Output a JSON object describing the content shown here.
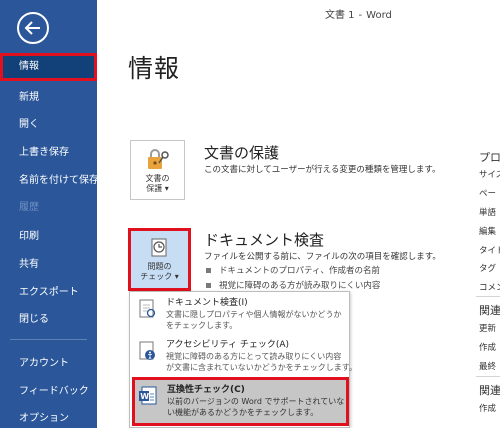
{
  "window": {
    "title": "文書 1",
    "dash": "-",
    "app": "Word"
  },
  "sidebar": {
    "items": [
      {
        "label": "情報"
      },
      {
        "label": "新規"
      },
      {
        "label": "開く"
      },
      {
        "label": "上書き保存"
      },
      {
        "label": "名前を付けて保存"
      },
      {
        "label": "履歴"
      },
      {
        "label": "印刷"
      },
      {
        "label": "共有"
      },
      {
        "label": "エクスポート"
      },
      {
        "label": "閉じる"
      },
      {
        "label": "アカウント"
      },
      {
        "label": "フィードバック"
      },
      {
        "label": "オプション"
      }
    ]
  },
  "page": {
    "title": "情報"
  },
  "protect": {
    "button_line1": "文書の",
    "button_line2": "保護",
    "title": "文書の保護",
    "desc": "この文書に対してユーザーが行える変更の種類を管理します。"
  },
  "inspect": {
    "button_line1": "問題の",
    "button_line2": "チェック",
    "title": "ドキュメント検査",
    "desc": "ファイルを公開する前に、ファイルの次の項目を確認します。",
    "bullets": [
      "ドキュメントのプロパティ、作成者の名前",
      "視覚に障碍のある方が読み取りにくい内容"
    ]
  },
  "menu": {
    "items": [
      {
        "title": "ドキュメント検査(I)",
        "desc1": "文書に隠しプロパティや個人情報がないかどうか",
        "desc2": "をチェックします。"
      },
      {
        "title": "アクセシビリティ チェック(A)",
        "desc1": "視覚に障碍のある方にとって読み取りにくい内容",
        "desc2": "が文書に含まれていないかどうかをチェックします。"
      },
      {
        "title": "互換性チェック(C)",
        "desc1": "以前のバージョンの Word でサポートされていな",
        "desc2": "い機能があるかどうかをチェックします。"
      }
    ]
  },
  "right_panel": {
    "heading1": "プロ",
    "props": [
      "サイズ",
      "ペー",
      "単語",
      "編集",
      "タイト",
      "タグ",
      "コメン"
    ],
    "heading2": "関連",
    "dates": [
      "更新",
      "作成",
      "最終"
    ],
    "heading3": "関連",
    "people": [
      "作成"
    ]
  },
  "colors": {
    "sidebar": "#2b579a",
    "highlight_border": "#e0101e",
    "inspect_button": "#c7ddf4"
  }
}
